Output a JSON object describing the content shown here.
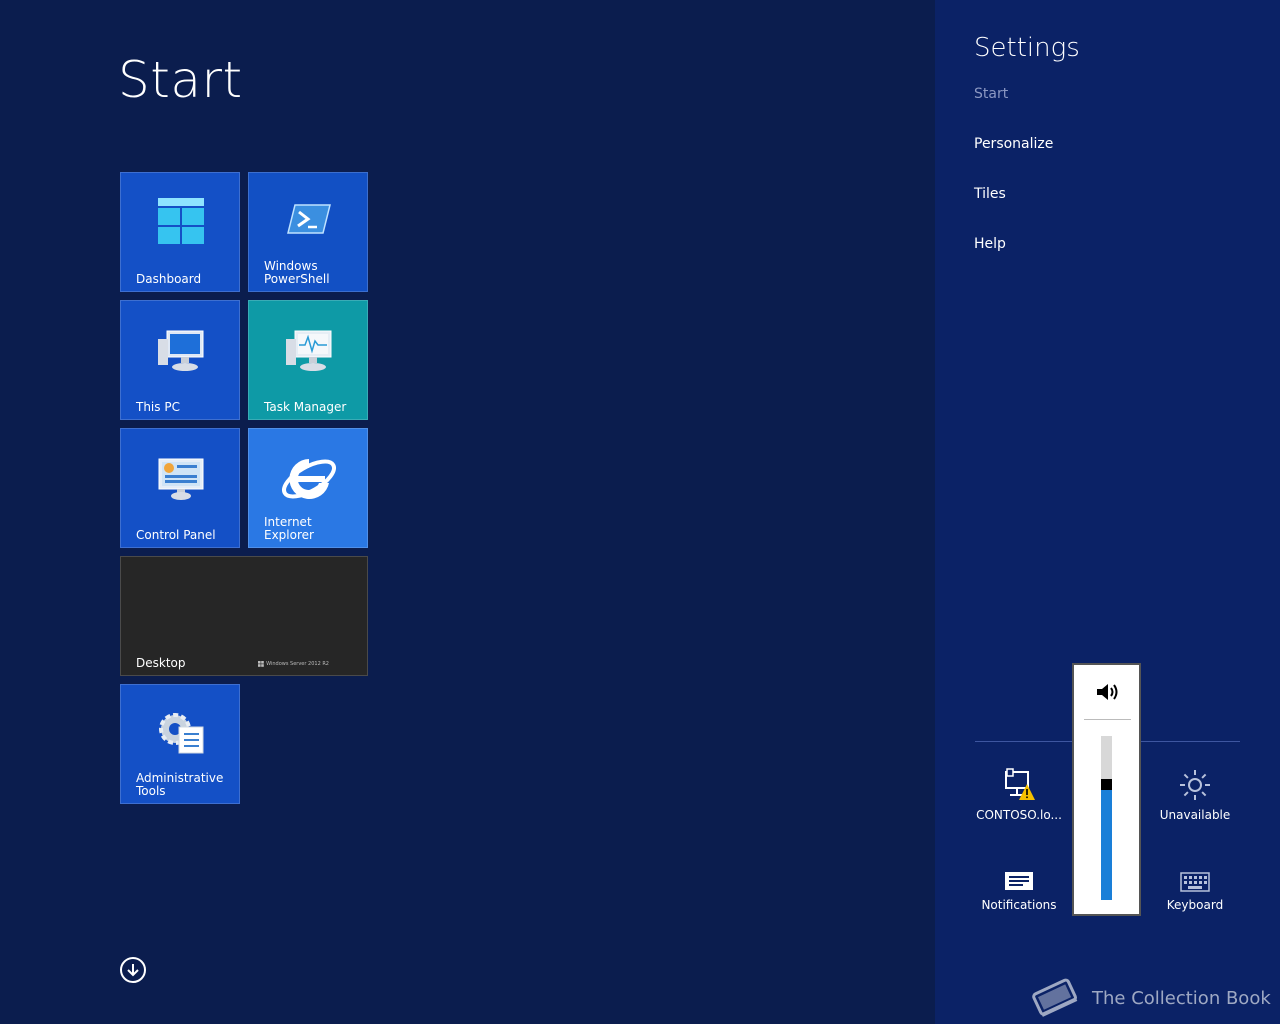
{
  "start": {
    "title": "Start",
    "tiles": [
      {
        "label": "Dashboard"
      },
      {
        "label": "Windows\nPowerShell"
      },
      {
        "label": "This PC"
      },
      {
        "label": "Task Manager"
      },
      {
        "label": "Control Panel"
      },
      {
        "label": "Internet Explorer"
      },
      {
        "label": "Desktop",
        "brand": "Windows Server 2012 R2"
      },
      {
        "label": "Administrative\nTools"
      }
    ]
  },
  "charm": {
    "title": "Settings",
    "items": [
      {
        "label": "Start",
        "enabled": false
      },
      {
        "label": "Personalize",
        "enabled": true
      },
      {
        "label": "Tiles",
        "enabled": true
      },
      {
        "label": "Help",
        "enabled": true
      }
    ],
    "quick": {
      "network": "CONTOSO.lo...",
      "brightness": "Unavailable",
      "notifications": "Notifications",
      "keyboard": "Keyboard"
    }
  },
  "volume": {
    "level_percent": 67
  },
  "watermark": {
    "text": "The Collection Book"
  },
  "colors": {
    "background": "#0b1d4e",
    "charm": "#0b2266",
    "tile_blue": "#1450c6",
    "tile_teal": "#0e9aa6",
    "tile_ie": "#2a78e4",
    "volume_fill": "#1a7fd8"
  }
}
